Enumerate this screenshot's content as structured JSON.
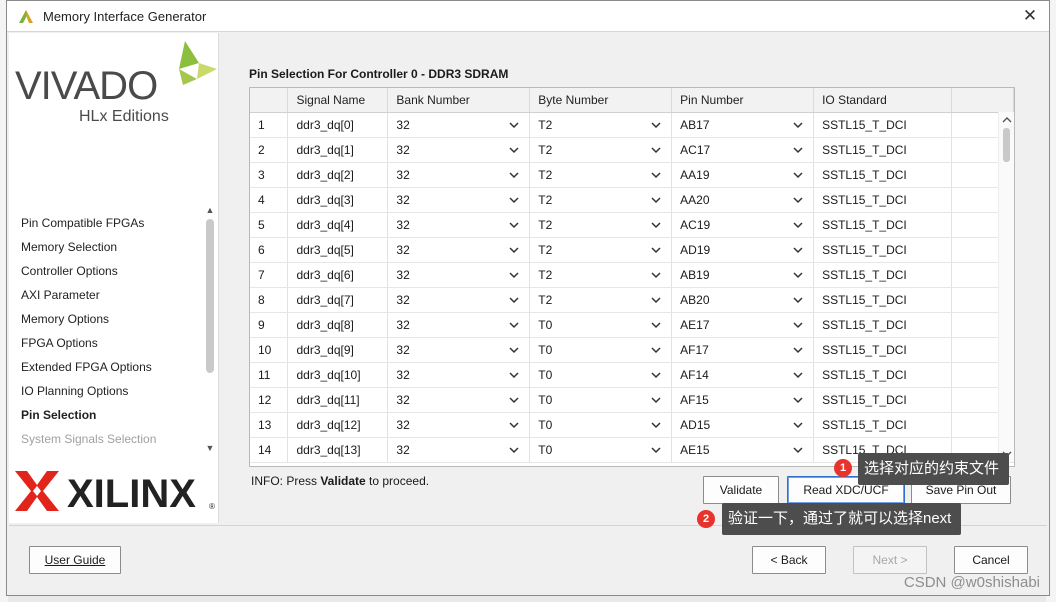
{
  "window": {
    "title": "Memory Interface Generator"
  },
  "brand": {
    "vivado_line1": "VIVADO",
    "vivado_line2": "HLx Editions",
    "xilinx": "XILINX"
  },
  "nav": {
    "items": [
      {
        "label": "Pin Compatible FPGAs",
        "state": "normal"
      },
      {
        "label": "Memory Selection",
        "state": "normal"
      },
      {
        "label": "Controller Options",
        "state": "normal"
      },
      {
        "label": "AXI Parameter",
        "state": "normal"
      },
      {
        "label": "Memory Options",
        "state": "normal"
      },
      {
        "label": "FPGA Options",
        "state": "normal"
      },
      {
        "label": "Extended FPGA Options",
        "state": "normal"
      },
      {
        "label": "IO Planning Options",
        "state": "normal"
      },
      {
        "label": "Pin Selection",
        "state": "active"
      },
      {
        "label": "System Signals Selection",
        "state": "faded"
      }
    ]
  },
  "main": {
    "title": "Pin Selection For Controller 0 - DDR3 SDRAM",
    "columns": [
      "",
      "Signal Name",
      "Bank Number",
      "Byte Number",
      "Pin Number",
      "IO Standard"
    ],
    "rows": [
      [
        "1",
        "ddr3_dq[0]",
        "32",
        "T2",
        "AB17",
        "SSTL15_T_DCI"
      ],
      [
        "2",
        "ddr3_dq[1]",
        "32",
        "T2",
        "AC17",
        "SSTL15_T_DCI"
      ],
      [
        "3",
        "ddr3_dq[2]",
        "32",
        "T2",
        "AA19",
        "SSTL15_T_DCI"
      ],
      [
        "4",
        "ddr3_dq[3]",
        "32",
        "T2",
        "AA20",
        "SSTL15_T_DCI"
      ],
      [
        "5",
        "ddr3_dq[4]",
        "32",
        "T2",
        "AC19",
        "SSTL15_T_DCI"
      ],
      [
        "6",
        "ddr3_dq[5]",
        "32",
        "T2",
        "AD19",
        "SSTL15_T_DCI"
      ],
      [
        "7",
        "ddr3_dq[6]",
        "32",
        "T2",
        "AB19",
        "SSTL15_T_DCI"
      ],
      [
        "8",
        "ddr3_dq[7]",
        "32",
        "T2",
        "AB20",
        "SSTL15_T_DCI"
      ],
      [
        "9",
        "ddr3_dq[8]",
        "32",
        "T0",
        "AE17",
        "SSTL15_T_DCI"
      ],
      [
        "10",
        "ddr3_dq[9]",
        "32",
        "T0",
        "AF17",
        "SSTL15_T_DCI"
      ],
      [
        "11",
        "ddr3_dq[10]",
        "32",
        "T0",
        "AF14",
        "SSTL15_T_DCI"
      ],
      [
        "12",
        "ddr3_dq[11]",
        "32",
        "T0",
        "AF15",
        "SSTL15_T_DCI"
      ],
      [
        "13",
        "ddr3_dq[12]",
        "32",
        "T0",
        "AD15",
        "SSTL15_T_DCI"
      ],
      [
        "14",
        "ddr3_dq[13]",
        "32",
        "T0",
        "AE15",
        "SSTL15_T_DCI"
      ]
    ],
    "info_prefix": "INFO: Press ",
    "info_bold": "Validate",
    "info_suffix": " to proceed."
  },
  "buttons": {
    "validate": "Validate",
    "read_xdc": "Read XDC/UCF",
    "save_pin_out": "Save Pin Out",
    "user_guide": "User Guide",
    "back": "< Back",
    "next": "Next >",
    "cancel": "Cancel"
  },
  "annotations": [
    {
      "number": "1",
      "text": "选择对应的约束文件"
    },
    {
      "number": "2",
      "text": "验证一下，通过了就可以选择next"
    }
  ],
  "watermark": "CSDN @w0shishabi",
  "colors": {
    "badge": "#e8332c",
    "callout": "#4d4d4d",
    "focus": "#2f6fd0"
  }
}
